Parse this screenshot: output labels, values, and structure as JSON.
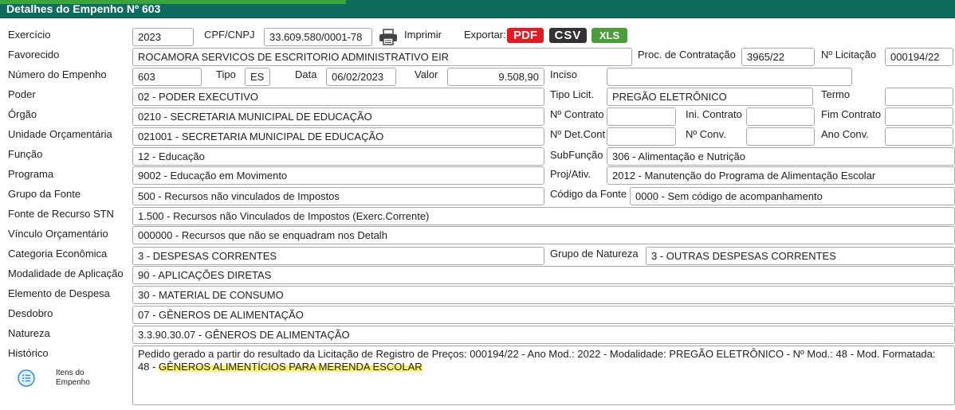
{
  "title": "Detalhes do Empenho Nº 603",
  "labels": {
    "exercicio": "Exercício",
    "cpf_cnpj": "CPF/CNPJ",
    "imprimir": "Imprimir",
    "exportar": "Exportar:",
    "favorecido": "Favorecido",
    "proc_contratacao": "Proc. de Contratação",
    "num_licitacao": "Nº Licitação",
    "numero_empenho": "Número do Empenho",
    "tipo": "Tipo",
    "data": "Data",
    "valor": "Valor",
    "inciso": "Inciso",
    "poder": "Poder",
    "tipo_licit": "Tipo Licit.",
    "termo": "Termo",
    "orgao": "Órgão",
    "num_contrato": "Nº Contrato",
    "ini_contrato": "Ini. Contrato",
    "fim_contrato": "Fim Contrato",
    "unidade_orcamentaria": "Unidade Orçamentária",
    "num_det_cont": "Nº Det.Cont",
    "num_conv": "Nº Conv.",
    "ano_conv": "Ano Conv.",
    "funcao": "Função",
    "subfuncao": "SubFunção",
    "programa": "Programa",
    "proj_ativ": "Proj/Ativ.",
    "grupo_fonte": "Grupo da Fonte",
    "codigo_fonte": "Código da Fonte",
    "fonte_recurso_stn": "Fonte de Recurso STN",
    "vinculo_orcamentario": "Vínculo Orçamentário",
    "categoria_economica": "Categoria Econômica",
    "grupo_natureza": "Grupo de Natureza",
    "modalidade_aplicacao": "Modalidade de Aplicação",
    "elemento_despesa": "Elemento de Despesa",
    "desdobro": "Desdobro",
    "natureza": "Natureza",
    "historico": "Histórico",
    "itens_empenho_1": "Itens do",
    "itens_empenho_2": "Empenho"
  },
  "export": {
    "pdf": "PDF",
    "csv": "CSV",
    "xls": "XLS"
  },
  "values": {
    "exercicio": "2023",
    "cpf_cnpj": "33.609.580/0001-78",
    "favorecido": "ROCAMORA SERVICOS DE ESCRITORIO ADMINISTRATIVO EIR",
    "proc_contratacao": "3965/22",
    "num_licitacao": "000194/22",
    "numero_empenho": "603",
    "tipo": "ES",
    "data": "06/02/2023",
    "valor": "9.508,90",
    "inciso": "",
    "poder": "02 - PODER EXECUTIVO",
    "tipo_licit": "PREGÃO ELETRÔNICO",
    "termo": "",
    "orgao": "0210 - SECRETARIA MUNICIPAL DE EDUCAÇÃO",
    "num_contrato": "",
    "ini_contrato": "",
    "fim_contrato": "",
    "unidade_orcamentaria": "021001 - SECRETARIA MUNICIPAL DE EDUCAÇÃO",
    "num_det_cont": "",
    "num_conv": "",
    "ano_conv": "",
    "funcao": "12 - Educação",
    "subfuncao": "306 - Alimentação e Nutrição",
    "programa": "9002 - Educação em Movimento",
    "proj_ativ": "2012 - Manutenção do Programa de Alimentação Escolar",
    "grupo_fonte": "500 - Recursos não vinculados de Impostos",
    "codigo_fonte": "0000 - Sem código de acompanhamento",
    "fonte_recurso_stn": "1.500 - Recursos não Vinculados de Impostos (Exerc.Corrente)",
    "vinculo_orcamentario": "000000 - Recursos que não se enquadram nos Detalh",
    "categoria_economica": "3 - DESPESAS CORRENTES",
    "grupo_natureza": "3 - OUTRAS DESPESAS CORRENTES",
    "modalidade_aplicacao": "90 - APLICAÇÕES DIRETAS",
    "elemento_despesa": "30 - MATERIAL DE CONSUMO",
    "desdobro": "07 - GÊNEROS DE ALIMENTAÇÃO",
    "natureza": "3.3.90.30.07 - GÊNEROS DE ALIMENTAÇÃO",
    "historico_part1": "Pedido gerado a partir do resultado da Licitação de Registro de Preços: 000194/22 - Ano Mod.: 2022 - Modalidade: PREGÃO ELETRÔNICO - Nº Mod.: 48 - Mod. Formatada: 48 - ",
    "historico_highlight": "GÊNEROS ALIMENTÍCIOS PARA MERENDA ESCOLAR"
  },
  "icons": {
    "print": "printer-icon",
    "items": "list-circle-icon"
  },
  "colors": {
    "header": "#0f6b5b",
    "header_accent": "#3aa63a",
    "pdf": "#e11b22",
    "csv": "#333333",
    "xls": "#4b9c3a",
    "highlight": "#ffee55"
  }
}
